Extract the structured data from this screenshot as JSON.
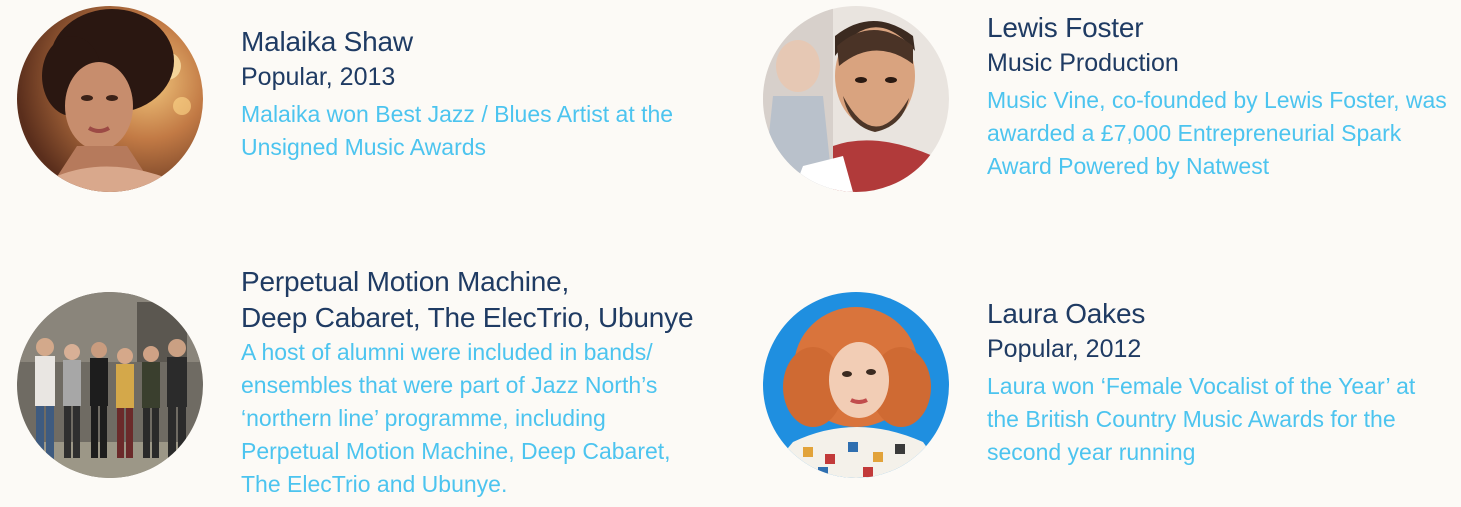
{
  "profiles": [
    {
      "name": "Malaika Shaw",
      "subtitle": "Popular, 2013",
      "description": "Malaika won Best Jazz / Blues Artist at the Unsigned Music Awards"
    },
    {
      "name": "Lewis Foster",
      "subtitle": "Music Production",
      "description": "Music Vine, co-founded by Lewis Foster, was awarded a £7,000 Entrepreneurial Spark Award Powered by Natwest"
    },
    {
      "name_lines": [
        "Perpetual Motion Machine,",
        "Deep Cabaret, The ElecTrio, Ubunye"
      ],
      "description": "A host of alumni were included in bands/ ensembles that were part of Jazz North’s ‘northern line’ programme, including Perpetual Motion Machine, Deep Cabaret, The ElecTrio and Ubunye."
    },
    {
      "name": "Laura Oakes",
      "subtitle": "Popular, 2012",
      "description": "Laura won ‘Female Vocalist of the Year’ at the British Country Music Awards for the second year running"
    }
  ],
  "colors": {
    "background": "#fcfaf6",
    "name_text": "#1f3b63",
    "description_text": "#4cc4ef"
  }
}
